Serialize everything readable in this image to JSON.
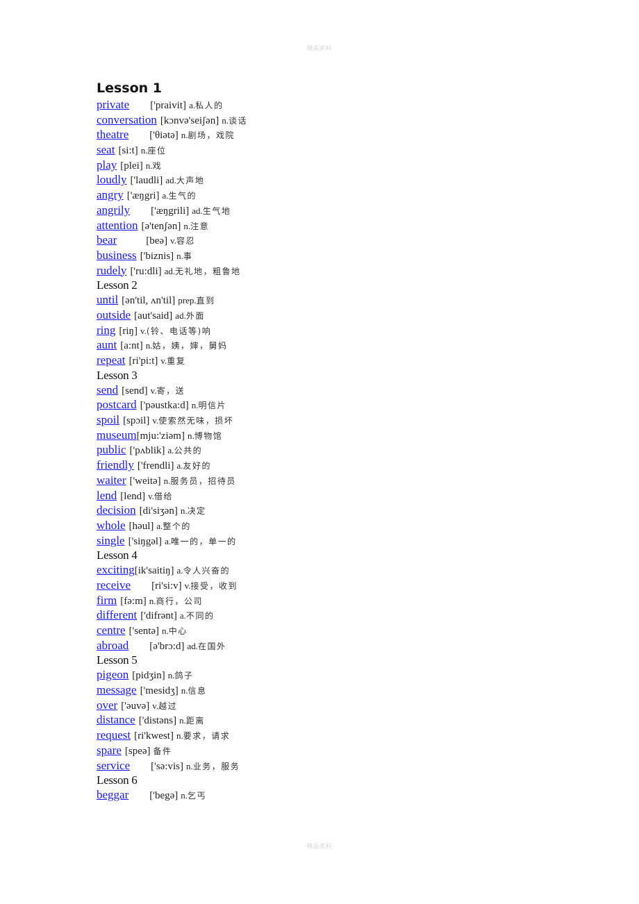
{
  "header": {
    "text": "精品资料"
  },
  "footer": {
    "text": "-精品资料-"
  },
  "colors": {
    "link": "#1a1aee",
    "text": "#222222"
  },
  "lessons": [
    {
      "title": "Lesson 1",
      "entries": [
        {
          "word": "private",
          "gap": 1,
          "phonetic": "['praivit]",
          "pos": "a.",
          "meaning": "私人的"
        },
        {
          "word": "conversation",
          "gap": 0,
          "phonetic": "[kɔnvə'seiʃən]",
          "pos": "n.",
          "meaning": "谈话"
        },
        {
          "word": "theatre",
          "gap": 1,
          "phonetic": "['θiətə]",
          "pos": "n.",
          "meaning": "剧场，戏院"
        },
        {
          "word": "seat",
          "gap": 0,
          "phonetic": "[si:t]",
          "pos": "n.",
          "meaning": "座位"
        },
        {
          "word": "play",
          "gap": 0,
          "phonetic": "[plei]",
          "pos": "n.",
          "meaning": "戏"
        },
        {
          "word": "loudly",
          "gap": 0,
          "phonetic": "['laudli]",
          "pos": "ad.",
          "meaning": "大声地"
        },
        {
          "word": "angry",
          "gap": 0,
          "phonetic": "['æŋgri]",
          "pos": "a.",
          "meaning": "生气的"
        },
        {
          "word": "angrily",
          "gap": 1,
          "phonetic": "['æŋgrili]",
          "pos": "ad.",
          "meaning": "生气地"
        },
        {
          "word": "attention",
          "gap": 0,
          "phonetic": "[ə'tenʃən]",
          "pos": "n.",
          "meaning": "注意"
        },
        {
          "word": "bear",
          "gap": 2,
          "phonetic": "[beə]",
          "pos": "v.",
          "meaning": "容忍"
        },
        {
          "word": "business",
          "gap": 0,
          "phonetic": "['biznis]",
          "pos": "n.",
          "meaning": "事"
        },
        {
          "word": "rudely",
          "gap": 0,
          "phonetic": "['ru:dli]",
          "pos": "ad.",
          "meaning": "无礼地，粗鲁地"
        }
      ]
    },
    {
      "title": "Lesson 2",
      "entries": [
        {
          "word": "until",
          "gap": 0,
          "phonetic": "[ən'til, ʌn'til]",
          "pos": "prep.",
          "meaning": "直到"
        },
        {
          "word": "outside",
          "gap": 0,
          "phonetic": "[aut'said]",
          "pos": "ad.",
          "meaning": "外面"
        },
        {
          "word": "ring",
          "gap": 0,
          "phonetic": "[riŋ]",
          "pos": "v.",
          "meaning": "(铃、电话等)响"
        },
        {
          "word": "aunt",
          "gap": 0,
          "phonetic": "[a:nt]",
          "pos": "n.",
          "meaning": "姑，姨，婶，舅妈"
        },
        {
          "word": "repeat",
          "gap": 0,
          "phonetic": "[ri'pi:t]",
          "pos": "v.",
          "meaning": "重复"
        }
      ]
    },
    {
      "title": "Lesson 3",
      "entries": [
        {
          "word": "send",
          "gap": 0,
          "phonetic": "[send]",
          "pos": "v.",
          "meaning": "寄，送"
        },
        {
          "word": "postcard",
          "gap": 0,
          "phonetic": "['pəustka:d]",
          "pos": "n.",
          "meaning": "明信片"
        },
        {
          "word": "spoil",
          "gap": 0,
          "phonetic": "[spɔil]",
          "pos": "v.",
          "meaning": "使索然无味，损坏"
        },
        {
          "word": "museum",
          "gap": -1,
          "phonetic": "[mju:'ziəm]",
          "pos": "n.",
          "meaning": "博物馆"
        },
        {
          "word": "public",
          "gap": 0,
          "phonetic": "['pʌblik]",
          "pos": "a.",
          "meaning": "公共的"
        },
        {
          "word": "friendly",
          "gap": 0,
          "phonetic": "['frendli]",
          "pos": "a.",
          "meaning": "友好的"
        },
        {
          "word": "waiter",
          "gap": 0,
          "phonetic": "['weitə]",
          "pos": "n.",
          "meaning": "服务员，招待员"
        },
        {
          "word": "lend",
          "gap": 0,
          "phonetic": "[lend]",
          "pos": "v.",
          "meaning": "借给"
        },
        {
          "word": "decision",
          "gap": 0,
          "phonetic": "[di'siʒən]",
          "pos": "n.",
          "meaning": "决定"
        },
        {
          "word": "whole",
          "gap": 0,
          "phonetic": "[həul]",
          "pos": "a.",
          "meaning": "整个的"
        },
        {
          "word": "single",
          "gap": 0,
          "phonetic": "['siŋgəl]",
          "pos": "a.",
          "meaning": "唯一的，单一的"
        }
      ]
    },
    {
      "title": "Lesson 4",
      "entries": [
        {
          "word": "exciting",
          "gap": -1,
          "phonetic": "[ik'saitiŋ]",
          "pos": "a.",
          "meaning": "令人兴奋的"
        },
        {
          "word": "receive",
          "gap": 1,
          "phonetic": "[ri'si:v]",
          "pos": "v.",
          "meaning": "接受，收到"
        },
        {
          "word": "firm",
          "gap": 0,
          "phonetic": "[fə:m]",
          "pos": "n.",
          "meaning": "商行，公司"
        },
        {
          "word": "different",
          "gap": 0,
          "phonetic": "['difrənt]",
          "pos": "a.",
          "meaning": "不同的"
        },
        {
          "word": "centre",
          "gap": 0,
          "phonetic": "['sentə]",
          "pos": "n.",
          "meaning": "中心"
        },
        {
          "word": "abroad",
          "gap": 1,
          "phonetic": "[ə'brɔ:d]",
          "pos": "ad.",
          "meaning": "在国外"
        }
      ]
    },
    {
      "title": "Lesson 5",
      "entries": [
        {
          "word": "pigeon",
          "gap": 0,
          "phonetic": "[pidʒin]",
          "pos": "n.",
          "meaning": "鸽子"
        },
        {
          "word": "message",
          "gap": 0,
          "phonetic": "['mesidʒ]",
          "pos": "n.",
          "meaning": "信息"
        },
        {
          "word": "over",
          "gap": 0,
          "phonetic": "['əuvə]",
          "pos": "v.",
          "meaning": "越过"
        },
        {
          "word": "distance",
          "gap": 0,
          "phonetic": "['distəns]",
          "pos": "n.",
          "meaning": "距离"
        },
        {
          "word": "request",
          "gap": 0,
          "phonetic": "[ri'kwest]",
          "pos": "n.",
          "meaning": "要求，请求"
        },
        {
          "word": "spare",
          "gap": 0,
          "phonetic": "[speə]",
          "pos": "",
          "meaning": " 备件"
        },
        {
          "word": "service",
          "gap": 1,
          "phonetic": "['sə:vis]",
          "pos": "n.",
          "meaning": "业务，服务"
        }
      ]
    },
    {
      "title": "Lesson 6",
      "entries": [
        {
          "word": "beggar",
          "gap": 1,
          "phonetic": "['begə]",
          "pos": "n.",
          "meaning": "乞丐"
        }
      ]
    }
  ]
}
